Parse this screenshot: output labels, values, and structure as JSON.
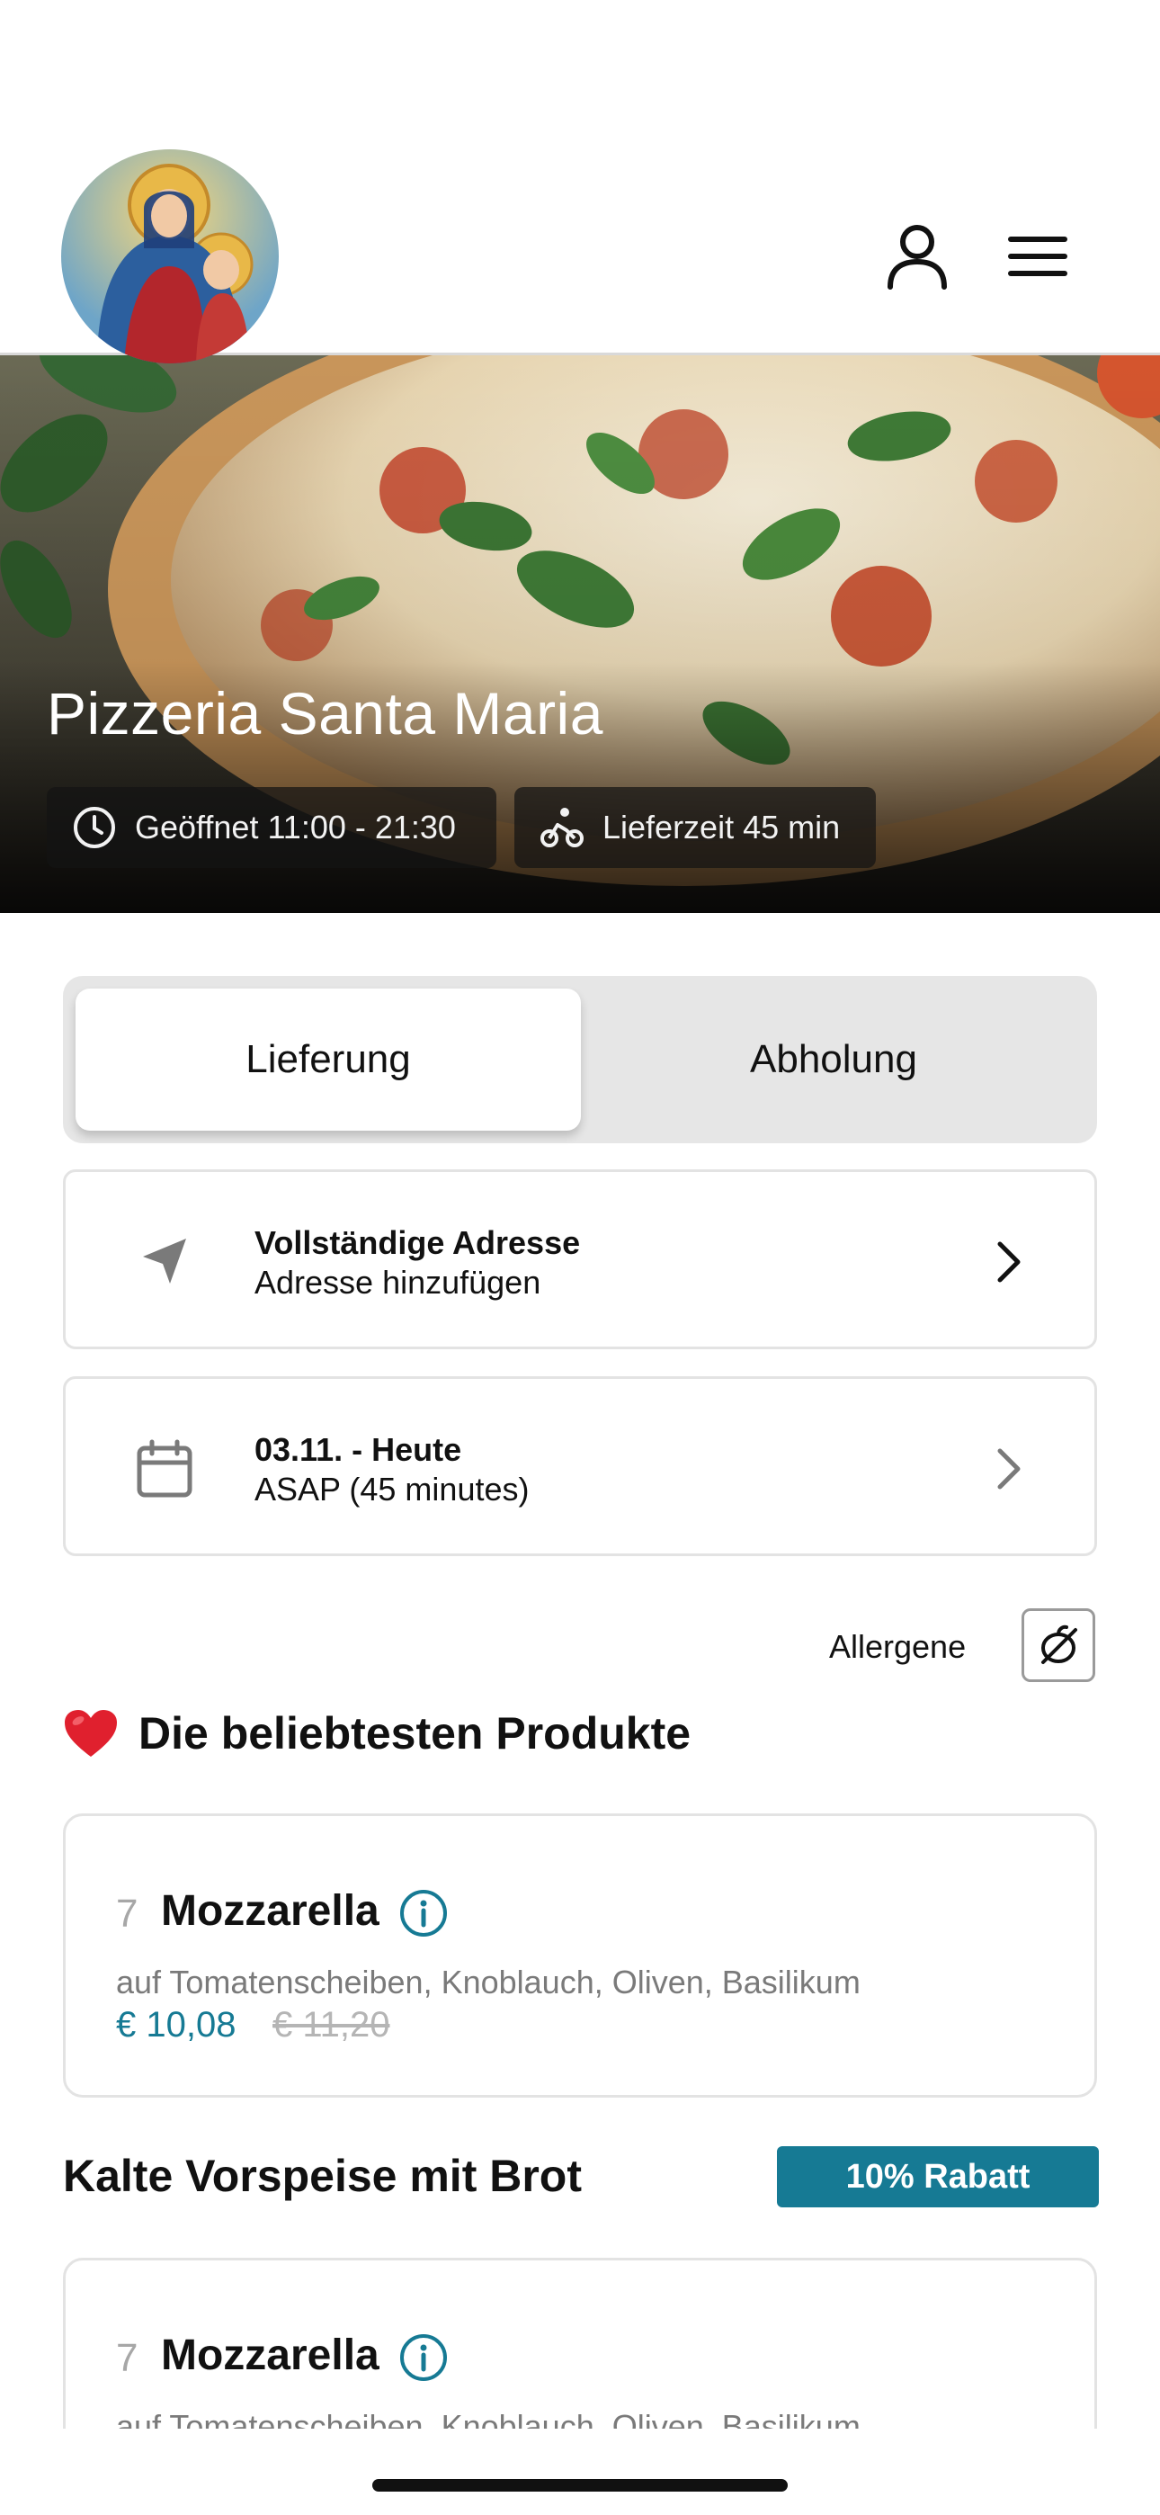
{
  "header": {
    "logo_name": "religious-portrait-logo",
    "account_icon": "user-icon",
    "menu_icon": "hamburger-menu-icon"
  },
  "hero": {
    "title": "Pizzeria Santa Maria",
    "open_label": "Geöffnet 11:00 - 21:30",
    "delivery_label": "Lieferzeit 45 min"
  },
  "mode_toggle": {
    "delivery": "Lieferung",
    "pickup": "Abholung",
    "selected": "Lieferung"
  },
  "address": {
    "title": "Vollständige Adresse",
    "subtitle": "Adresse hinzufügen"
  },
  "schedule": {
    "title": "03.11. - Heute",
    "subtitle": "ASAP (45 minutes)"
  },
  "allergens": {
    "label": "Allergene"
  },
  "popular": {
    "title": "Die beliebtesten Produkte",
    "product": {
      "number": "7",
      "name": "Mozzarella",
      "description": "auf Tomatenscheiben, Knoblauch, Oliven, Basilikum",
      "price": "€ 10,08",
      "old_price": "€ 11,20"
    }
  },
  "cold_starters": {
    "title": "Kalte Vorspeise mit Brot",
    "badge": "10% Rabatt",
    "product": {
      "number": "7",
      "name": "Mozzarella",
      "description": "auf Tomatenscheiben, Knoblauch, Oliven, Basilikum"
    }
  },
  "colors": {
    "accent": "#167a94",
    "card_border": "#e3e3e3",
    "toggle_bg": "#e6e6e6"
  }
}
